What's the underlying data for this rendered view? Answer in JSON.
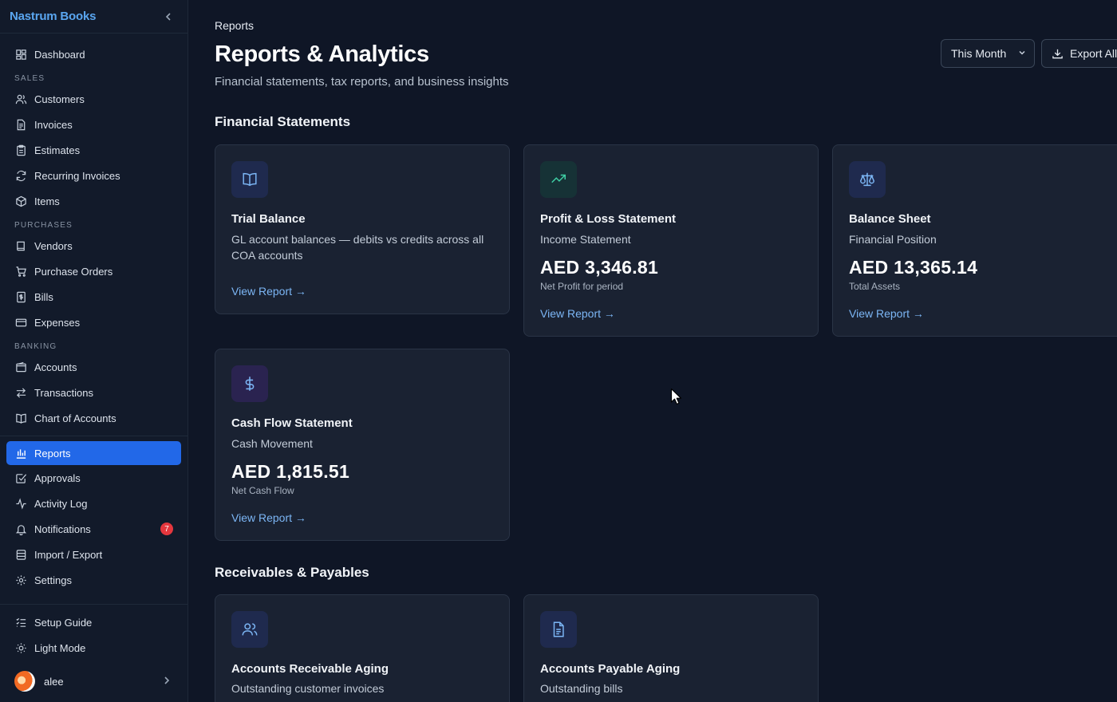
{
  "brand": {
    "name": "Nastrum Books"
  },
  "nav": {
    "dashboard": "Dashboard",
    "sales_label": "SALES",
    "customers": "Customers",
    "invoices": "Invoices",
    "estimates": "Estimates",
    "recurring": "Recurring Invoices",
    "items": "Items",
    "purchases_label": "PURCHASES",
    "vendors": "Vendors",
    "purchase_orders": "Purchase Orders",
    "bills": "Bills",
    "expenses": "Expenses",
    "banking_label": "BANKING",
    "accounts": "Accounts",
    "transactions": "Transactions",
    "coa": "Chart of Accounts",
    "reports": "Reports",
    "approvals": "Approvals",
    "activity": "Activity Log",
    "notifications": "Notifications",
    "notifications_count": "7",
    "import_export": "Import / Export",
    "settings": "Settings",
    "setup": "Setup Guide",
    "light_mode": "Light Mode"
  },
  "user": {
    "name": "alee"
  },
  "header": {
    "breadcrumb": "Reports",
    "title": "Reports & Analytics",
    "subtitle": "Financial statements, tax reports, and business insights",
    "period": "This Month",
    "export": "Export All"
  },
  "sections": {
    "financial": "Financial Statements",
    "receivables": "Receivables & Payables"
  },
  "cards": {
    "trial": {
      "title": "Trial Balance",
      "desc": "GL account balances — debits vs credits across all COA accounts",
      "link": "View Report →"
    },
    "pl": {
      "title": "Profit & Loss Statement",
      "desc": "Income Statement",
      "amount": "AED 3,346.81",
      "amount_label": "Net Profit for period",
      "link": "View Report →"
    },
    "bs": {
      "title": "Balance Sheet",
      "desc": "Financial Position",
      "amount": "AED 13,365.14",
      "amount_label": "Total Assets",
      "link": "View Report →"
    },
    "cf": {
      "title": "Cash Flow Statement",
      "desc": "Cash Movement",
      "amount": "AED 1,815.51",
      "amount_label": "Net Cash Flow",
      "link": "View Report →"
    },
    "ar": {
      "title": "Accounts Receivable Aging",
      "desc": "Outstanding customer invoices"
    },
    "ap": {
      "title": "Accounts Payable Aging",
      "desc": "Outstanding bills"
    }
  },
  "colors": {
    "accent": "#2268e8",
    "link": "#7cb6f5",
    "badge": "#e5373e"
  }
}
